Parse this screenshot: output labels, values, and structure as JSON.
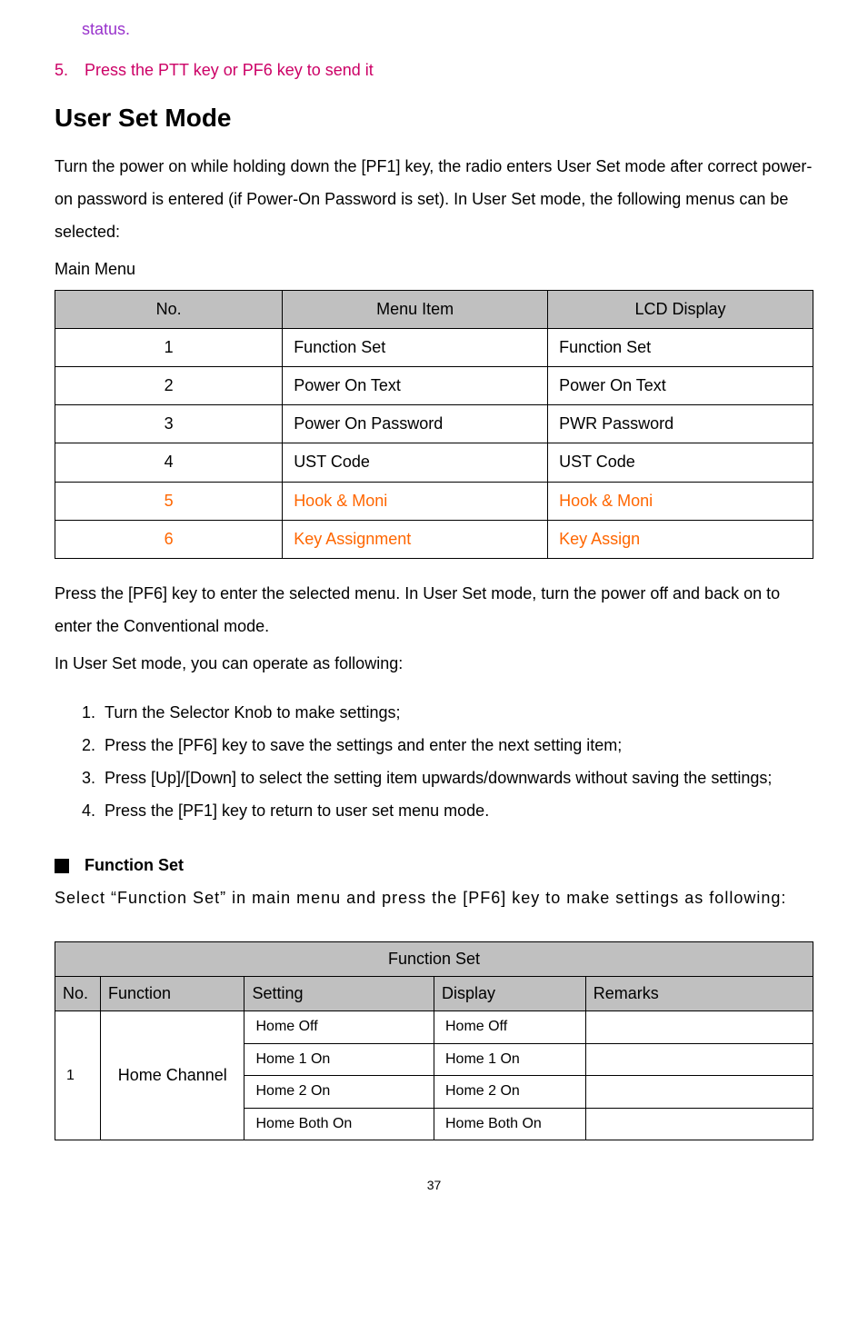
{
  "intro": {
    "status_line": "status.",
    "step5": "5. Press the PTT key or PF6 key to send it"
  },
  "heading": "User Set Mode",
  "para1": "Turn the power on while holding down the [PF1] key, the radio enters User Set mode after correct power-on password is entered (if Power-On Password is set). In User Set mode, the following menus can be selected:",
  "main_menu_label": "Main Menu",
  "table1": {
    "headers": [
      "No.",
      "Menu Item",
      "LCD Display"
    ],
    "rows": [
      {
        "no": "1",
        "item": "Function Set",
        "display": "Function Set",
        "orange": false
      },
      {
        "no": "2",
        "item": "Power On Text",
        "display": "Power On Text",
        "orange": false
      },
      {
        "no": "3",
        "item": "Power On Password",
        "display": "PWR Password",
        "orange": false
      },
      {
        "no": "4",
        "item": "UST Code",
        "display": "UST Code",
        "orange": false
      },
      {
        "no": "5",
        "item": "Hook & Moni",
        "display": "Hook & Moni",
        "orange": true
      },
      {
        "no": "6",
        "item": "Key Assignment",
        "display": "Key Assign",
        "orange": true
      }
    ]
  },
  "para2": "Press the [PF6] key to enter the selected menu. In User Set mode, turn the power off and back on to enter the Conventional mode.",
  "para3": "In User Set mode, you can operate as following:",
  "steps": [
    "Turn the Selector Knob to make settings;",
    "Press the [PF6] key to save the settings and enter the next setting item;",
    "Press [Up]/[Down] to select the setting item upwards/downwards without saving the settings;",
    "Press the [PF1] key to return to user set menu mode."
  ],
  "function_set": {
    "title": "Function Set",
    "para": "Select “Function Set” in main menu and press the [PF6] key to make settings as following:"
  },
  "table2": {
    "title": "Function Set",
    "headers": [
      "No.",
      "Function",
      "Setting",
      "Display",
      "Remarks"
    ],
    "row": {
      "no": "1",
      "function": "Home Channel",
      "settings": [
        {
          "setting": "Home Off",
          "display": "Home Off",
          "remarks": ""
        },
        {
          "setting": "Home 1 On",
          "display": "Home 1 On",
          "remarks": ""
        },
        {
          "setting": "Home 2 On",
          "display": "Home 2 On",
          "remarks": ""
        },
        {
          "setting": "Home Both On",
          "display": "Home Both On",
          "remarks": ""
        }
      ]
    }
  },
  "page_number": "37"
}
